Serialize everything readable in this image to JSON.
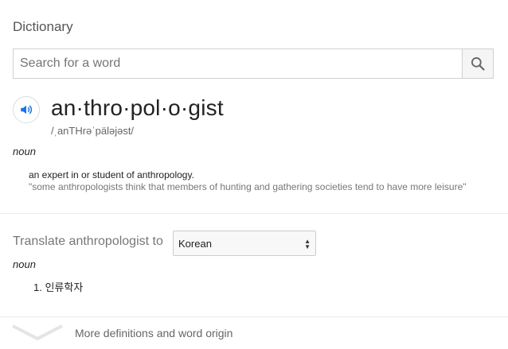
{
  "header": {
    "title": "Dictionary"
  },
  "search": {
    "placeholder": "Search for a word",
    "value": ""
  },
  "entry": {
    "headword": "an·thro·pol·o·gist",
    "phonetic": "/ˌanTHrəˈpäləjəst/",
    "part_of_speech": "noun",
    "definition": "an expert in or student of anthropology.",
    "example": "\"some anthropologists think that members of hunting and gathering societies tend to have more leisure\""
  },
  "translate": {
    "label": "Translate anthropologist to",
    "language": "Korean",
    "part_of_speech": "noun",
    "items": [
      "1. 인류학자"
    ]
  },
  "footer": {
    "more_label": "More definitions and word origin"
  },
  "colors": {
    "accent": "#1a73e8",
    "divider": "#ebebeb"
  },
  "icons": {
    "search": "search-icon",
    "speaker": "speaker-icon",
    "expand": "chevron-down-icon"
  }
}
